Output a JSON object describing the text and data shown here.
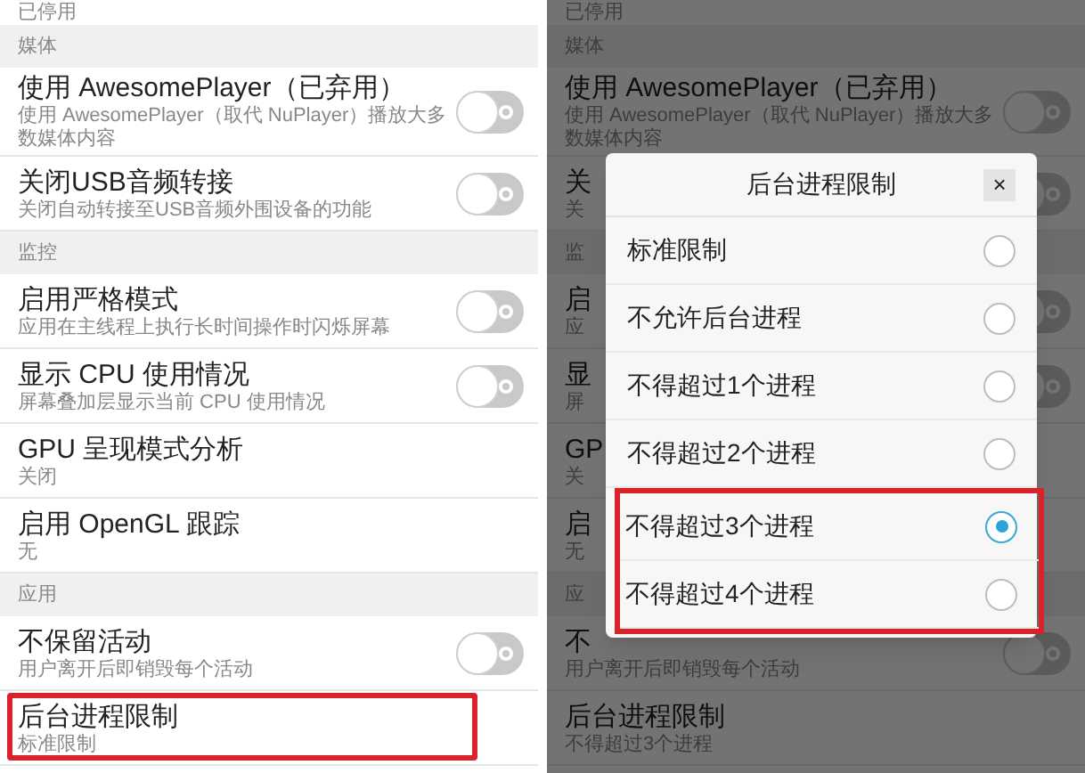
{
  "panels": [
    {
      "dim": false,
      "items": [
        {
          "kind": "cut",
          "subtitle": "已停用"
        },
        {
          "kind": "header",
          "title": "媒体"
        },
        {
          "kind": "toggle",
          "title": "使用 AwesomePlayer（已弃用）",
          "subtitle": "使用 AwesomePlayer（取代 NuPlayer）播放大多数媒体内容",
          "on": false
        },
        {
          "kind": "toggle",
          "title": "关闭USB音频转接",
          "subtitle": "关闭自动转接至USB音频外围设备的功能",
          "on": false
        },
        {
          "kind": "header",
          "title": "监控"
        },
        {
          "kind": "toggle",
          "title": "启用严格模式",
          "subtitle": "应用在主线程上执行长时间操作时闪烁屏幕",
          "on": false
        },
        {
          "kind": "toggle",
          "title": "显示 CPU 使用情况",
          "subtitle": "屏幕叠加层显示当前 CPU 使用情况",
          "on": false
        },
        {
          "kind": "plain",
          "title": "GPU 呈现模式分析",
          "subtitle": "关闭"
        },
        {
          "kind": "plain",
          "title": "启用 OpenGL 跟踪",
          "subtitle": "无"
        },
        {
          "kind": "header",
          "title": "应用"
        },
        {
          "kind": "toggle",
          "title": "不保留活动",
          "subtitle": "用户离开后即销毁每个活动",
          "on": false
        },
        {
          "kind": "plain",
          "title": "后台进程限制",
          "subtitle": "标准限制",
          "highlighted": true
        }
      ]
    },
    {
      "dim": true,
      "items": [
        {
          "kind": "cut",
          "subtitle": "已停用"
        },
        {
          "kind": "header",
          "title": "媒体"
        },
        {
          "kind": "toggle",
          "title": "使用 AwesomePlayer（已弃用）",
          "subtitle": "使用 AwesomePlayer（取代 NuPlayer）播放大多数媒体内容",
          "on": false
        },
        {
          "kind": "toggle",
          "title": "关",
          "subtitle": "关",
          "on": false
        },
        {
          "kind": "header",
          "title": "监"
        },
        {
          "kind": "toggle",
          "title": "启",
          "subtitle": "应",
          "on": false
        },
        {
          "kind": "toggle",
          "title": "显",
          "subtitle": "屏",
          "on": false
        },
        {
          "kind": "plain",
          "title": "GP",
          "subtitle": "关"
        },
        {
          "kind": "plain",
          "title": "启",
          "subtitle": "无"
        },
        {
          "kind": "header",
          "title": "应"
        },
        {
          "kind": "toggle",
          "title": "不",
          "subtitle": "用户离开后即销毁每个活动",
          "on": false
        },
        {
          "kind": "plain",
          "title": "后台进程限制",
          "subtitle": "不得超过3个进程"
        }
      ],
      "dialog": {
        "title": "后台进程限制",
        "close": "×",
        "options": [
          {
            "label": "标准限制",
            "selected": false,
            "highlighted": false
          },
          {
            "label": "不允许后台进程",
            "selected": false,
            "highlighted": false
          },
          {
            "label": "不得超过1个进程",
            "selected": false,
            "highlighted": false
          },
          {
            "label": "不得超过2个进程",
            "selected": false,
            "highlighted": false
          },
          {
            "label": "不得超过3个进程",
            "selected": true,
            "highlighted": true
          },
          {
            "label": "不得超过4个进程",
            "selected": false,
            "highlighted": true
          }
        ]
      }
    }
  ]
}
